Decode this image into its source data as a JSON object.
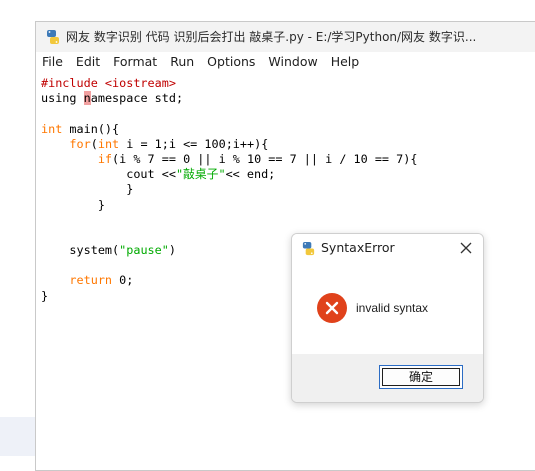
{
  "window": {
    "title": "网友 数字识别 代码  识别后会打出 敲桌子.py - E:/学习Python/网友 数字识..."
  },
  "menu": [
    "File",
    "Edit",
    "Format",
    "Run",
    "Options",
    "Window",
    "Help"
  ],
  "code": {
    "lines": [
      "#include <iostream>",
      "using namespace std;",
      "",
      "int main(){",
      "    for(int i = 1;i <= 100;i++){",
      "        if(i % 7 == 0 || i % 10 == 7 || i / 10 == 7){",
      "            cout <<\"敲桌子\"<< end;",
      "            }",
      "        }",
      "",
      "",
      "    system(\"pause\")",
      "",
      "    return 0;",
      "}"
    ]
  },
  "dialog": {
    "title": "SyntaxError",
    "message": "invalid syntax",
    "ok_label": "确定",
    "icon": "error-icon"
  },
  "colors": {
    "keyword": "#ff7700",
    "preprocessor": "#c00000",
    "string": "#00aa00",
    "error_icon": "#e0421b"
  }
}
